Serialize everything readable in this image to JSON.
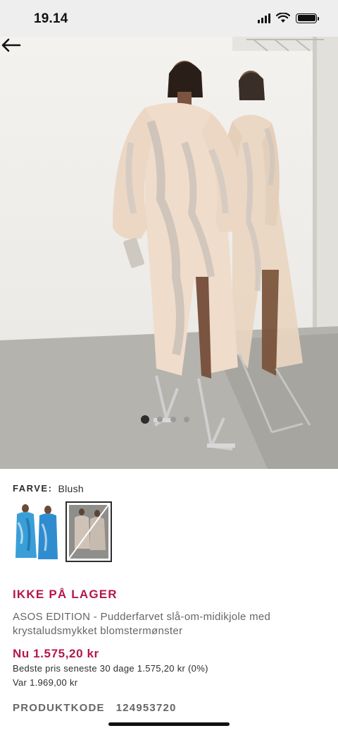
{
  "status_bar": {
    "time": "19.14",
    "icons": [
      "cellular-signal-icon",
      "wifi-icon",
      "battery-icon"
    ]
  },
  "gallery": {
    "back_icon": "arrow-left-icon",
    "image_count": 4,
    "active_index": 0,
    "image_alt": "ASOS EDITION - Pudderfarvet slå-om-midikjole med krystaludsmykket blomstermønster"
  },
  "product": {
    "colour_label": "FARVE:",
    "colour_value": "Blush",
    "colour_options": [
      {
        "name": "blue-floral",
        "available": true
      },
      {
        "name": "blush",
        "available": false,
        "selected": true
      }
    ],
    "stock_status": "IKKE PÅ LAGER",
    "title": "ASOS EDITION - Pudderfarvet slå-om-midikjole med krystaludsmykket blomstermønster",
    "current_price": "Nu 1.575,20 kr",
    "best_price_text": "Bedste pris seneste 30 dage 1.575,20 kr (0%)",
    "was_price_text": "Var 1.969,00 kr",
    "code_label": "PRODUKTKODE",
    "code_value": "124953720"
  },
  "colors": {
    "accent": "#b5164f",
    "text": "#2d2d2d",
    "muted": "#666666",
    "status_bar_bg": "#eeeeee"
  }
}
